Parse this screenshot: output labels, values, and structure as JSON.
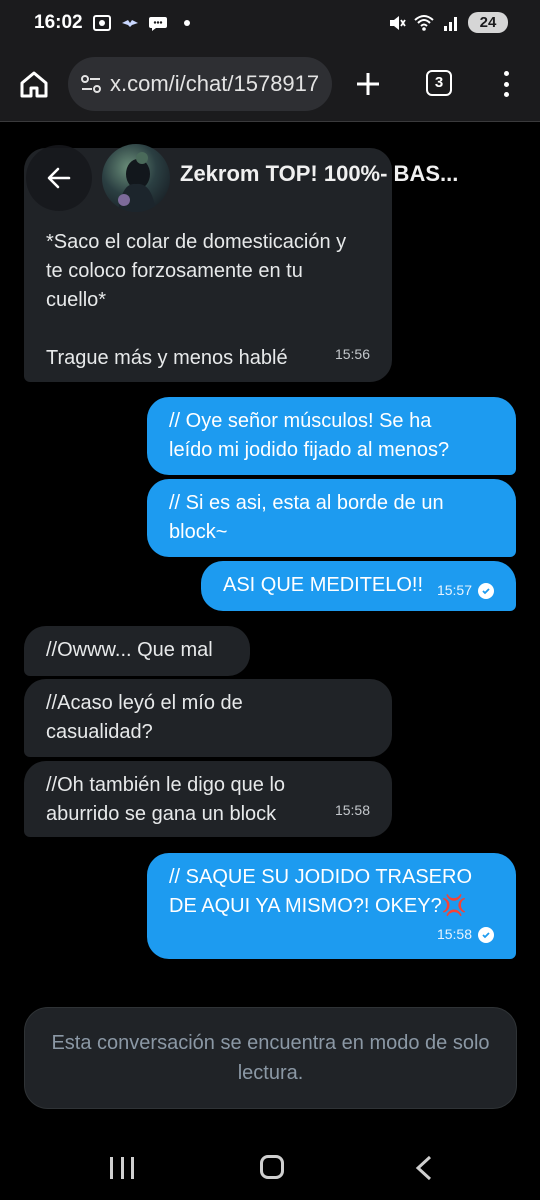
{
  "status_bar": {
    "time": "16:02",
    "battery": "24"
  },
  "browser": {
    "url": "x.com/i/chat/1578917",
    "tab_count": "3"
  },
  "chat": {
    "contact_name": "Zekrom TOP! 100%- BAS...",
    "messages": [
      {
        "direction": "in",
        "text": "*Saco el colar de domesticación y\nte coloco forzosamente en tu\ncuello*\n\nTrague más y menos hablé",
        "time": "15:56"
      },
      {
        "direction": "out",
        "text": "// Oye señor músculos! Se ha\nleído mi jodido fijado al menos?",
        "time": ""
      },
      {
        "direction": "out",
        "text": "// Si es asi, esta al borde de un\nblock~",
        "time": ""
      },
      {
        "direction": "out",
        "text": "ASI QUE MEDITELO!!",
        "time": "15:57"
      },
      {
        "direction": "in",
        "text": "//Owww... Que mal",
        "time": ""
      },
      {
        "direction": "in",
        "text": "//Acaso leyó el mío de\ncasualidad?",
        "time": ""
      },
      {
        "direction": "in",
        "text": "//Oh también le digo que lo\naburrido se gana un block",
        "time": "15:58"
      },
      {
        "direction": "out",
        "text": "// SAQUE SU JODIDO TRASERO\nDE AQUI YA MISMO?! OKEY?💢",
        "time": "15:58"
      }
    ],
    "readonly_notice": "Esta conversación se encuentra en modo de solo lectura."
  },
  "colors": {
    "outgoing_bubble": "#1d9bf0",
    "incoming_bubble": "#202327",
    "background": "#000000"
  }
}
